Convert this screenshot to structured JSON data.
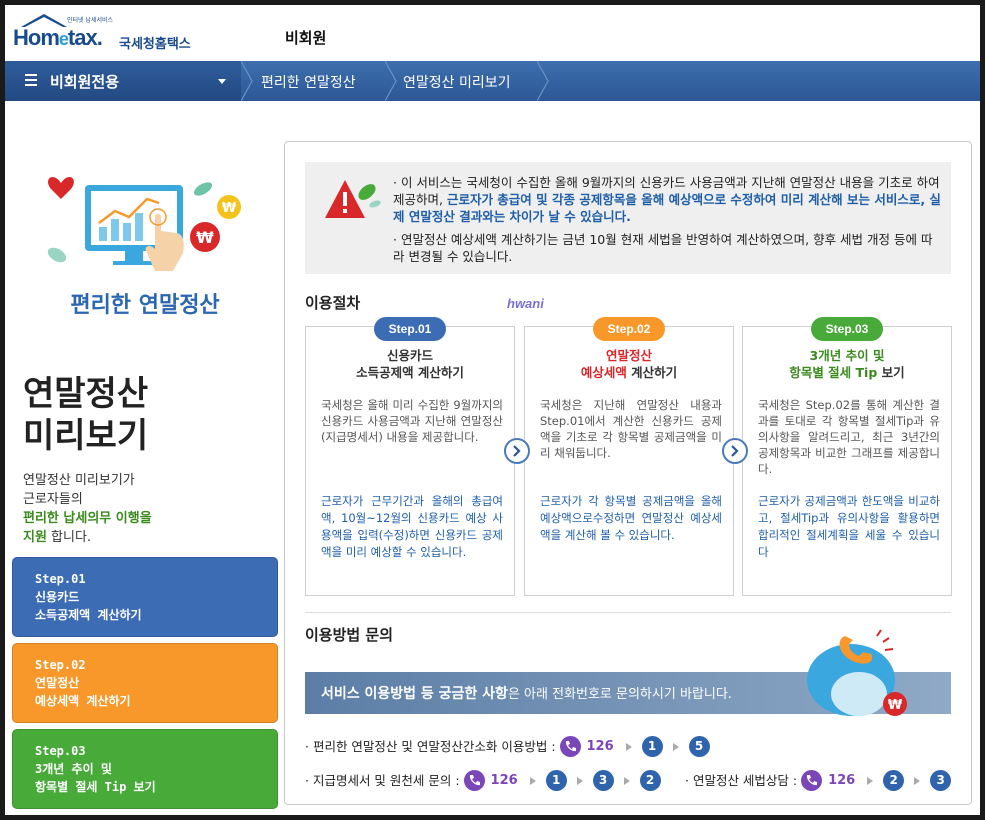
{
  "header": {
    "logo_sub": "인터넷 납세서비스",
    "logo_main_1": "Hom",
    "logo_main_e": "e",
    "logo_main_2": "tax.",
    "logo_kr": "국세청홈택스",
    "member_status": "비회원"
  },
  "nav": {
    "menu_label": "비회원전용",
    "breadcrumbs": [
      "편리한 연말정산",
      "연말정산 미리보기"
    ]
  },
  "left": {
    "illustration_title": "편리한 연말정산",
    "title_line1": "연말정산",
    "title_line2": "미리보기",
    "desc_1": "연말정산 미리보기가",
    "desc_2": "근로자들의",
    "desc_hl_1": "편리한 납세의무 이행을",
    "desc_hl_2": "지원",
    "desc_end": " 합니다.",
    "steps": [
      {
        "num": "Step.01",
        "line1": "신용카드",
        "line2": "소득공제액 계산하기"
      },
      {
        "num": "Step.02",
        "line1": "연말정산",
        "line2": "예상세액 계산하기"
      },
      {
        "num": "Step.03",
        "line1": "3개년 추이 및",
        "line2": "항목별 절세 Tip 보기"
      }
    ]
  },
  "notice": {
    "p1_a": "· 이 서비스는 국세청이 수집한 올해 9월까지의 신용카드 사용금액과 지난해 연말정산 내용을 기초로 하여 제공하며, ",
    "p1_b": "근로자가 총급여 및 각종 공제항목을 올해 예상액으로 수정하여 미리 계산해 보는 서비스로, 실제 연말정산 결과와는 차이가 날 수 있습니다.",
    "p2": "· 연말정산 예상세액 계산하기는 금년 10월 현재 세법을 반영하여 계산하였으며, 향후 세법 개정 등에 따라 변경될 수 있습니다."
  },
  "procedure": {
    "title": "이용절차",
    "watermark": "hwani",
    "cards": [
      {
        "pill": "Step.01",
        "head1": "신용카드",
        "head2": "소득공제액 계산하기",
        "body": "국세청은 올해 미리 수집한 9월까지의 신용카드 사용금액과 지난해 연말정산(지급명세서) 내용을 제공합니다.",
        "blue": "근로자가 근무기간과 올해의 총급여액, 10월~12월의 신용카드 예상 사용액을 입력(수정)하면 신용카드 공제액을 미리 예상할 수 있습니다."
      },
      {
        "pill": "Step.02",
        "head1": "연말정산",
        "head2a": "예상세액",
        "head2b": " 계산하기",
        "body": "국세청은 지난해 연말정산 내용과 Step.01에서 계산한 신용카드 공제액을 기초로 각 항목별 공제금액을 미리 채워둡니다.",
        "blue": "근로자가 각 항목별 공제금액을 올해예상액으로수정하면 연말정산 예상세액을 계산해 볼 수 있습니다."
      },
      {
        "pill": "Step.03",
        "head1": "3개년 추이 및",
        "head2a": "항목별 절세 Tip",
        "head2b": " 보기",
        "body": "국세청은 Step.02를 통해 계산한 결과를 토대로 각 항목별 절세Tip과 유의사항을 알려드리고, 최근 3년간의 공제항목과 비교한 그래프를 제공합니다.",
        "blue": "근로자가 공제금액과 한도액을 비교하고, 절세Tip과 유의사항을 활용하면 합리적인 절세계획을 세울 수 있습니다"
      }
    ]
  },
  "inquiry": {
    "title": "이용방법 문의",
    "banner_bold": "서비스 이용방법 등 궁금한 사항",
    "banner_rest": "은 아래 전화번호로 문의하시기 바랍니다.",
    "rows": [
      {
        "label": "· 편리한 연말정산 및 연말정산간소화 이용방법 :",
        "phone": "126",
        "steps": [
          "1",
          "5"
        ]
      },
      {
        "label": "· 지급명세서  및 원천세 문의 :",
        "phone": "126",
        "steps": [
          "1",
          "3",
          "2"
        ]
      },
      {
        "label": "· 연말정산 세법상담  :",
        "phone": "126",
        "steps": [
          "2",
          "3"
        ]
      }
    ]
  },
  "colors": {
    "brand_blue": "#2c5795",
    "step1": "#3c6cb4",
    "step2": "#f8982a",
    "step3": "#48ab39",
    "phone_purple": "#7a46b8"
  }
}
